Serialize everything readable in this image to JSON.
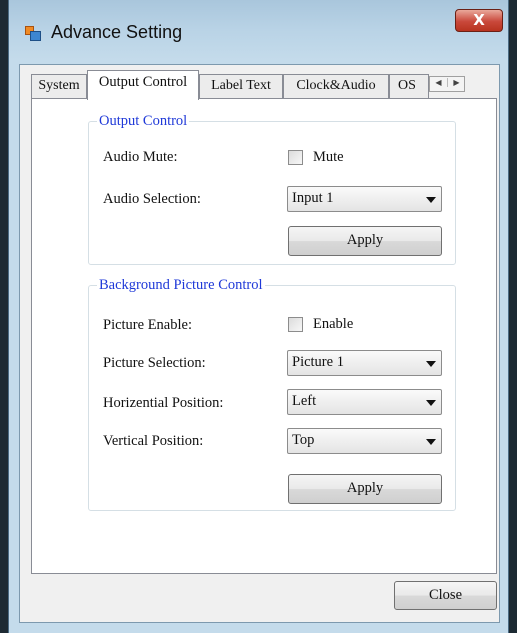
{
  "window": {
    "title": "Advance Setting",
    "close_glyph": "X"
  },
  "tabs": [
    {
      "label": "System"
    },
    {
      "label": "Output Control"
    },
    {
      "label": "Label Text"
    },
    {
      "label": "Clock&Audio"
    },
    {
      "label": "OS"
    }
  ],
  "tab_scroll": {
    "left": "◀",
    "right": "▶"
  },
  "output_control": {
    "title": "Output Control",
    "audio_mute_label": "Audio Mute:",
    "mute_checkbox_label": "Mute",
    "audio_selection_label": "Audio Selection:",
    "audio_selection_value": "Input 1",
    "apply_label": "Apply"
  },
  "background_picture": {
    "title": "Background Picture Control",
    "picture_enable_label": "Picture Enable:",
    "enable_checkbox_label": "Enable",
    "picture_selection_label": "Picture Selection:",
    "picture_selection_value": "Picture 1",
    "horizontal_position_label": "Horizential Position:",
    "horizontal_position_value": "Left",
    "vertical_position_label": "Vertical Position:",
    "vertical_position_value": "Top",
    "apply_label": "Apply"
  },
  "footer": {
    "close_label": "Close"
  }
}
